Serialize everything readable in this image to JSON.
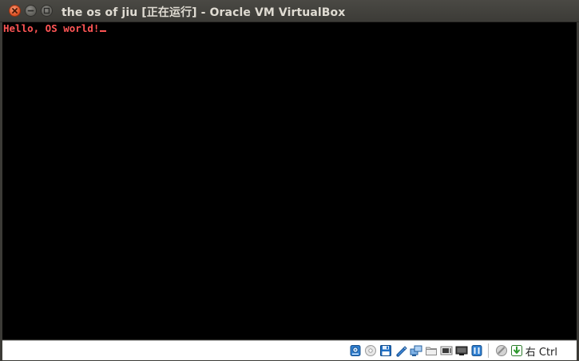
{
  "window": {
    "title": "the os of jiu [正在运行] - Oracle VM VirtualBox",
    "buttons": [
      "close-icon",
      "minimize-icon",
      "maximize-icon"
    ]
  },
  "screen": {
    "console_line": "Hello, OS world!",
    "text_color": "#ff5555",
    "background": "#000000"
  },
  "statusbar": {
    "icons": [
      "hard-disk-icon",
      "optical-drive-icon",
      "floppy-icon",
      "usb-icon",
      "shared-folders-icon",
      "display-icon",
      "video-capture-icon",
      "network-icon",
      "cpu-icon",
      "mouse-integration-icon",
      "keyboard-capture-icon"
    ],
    "host_key_label": "右 Ctrl"
  }
}
